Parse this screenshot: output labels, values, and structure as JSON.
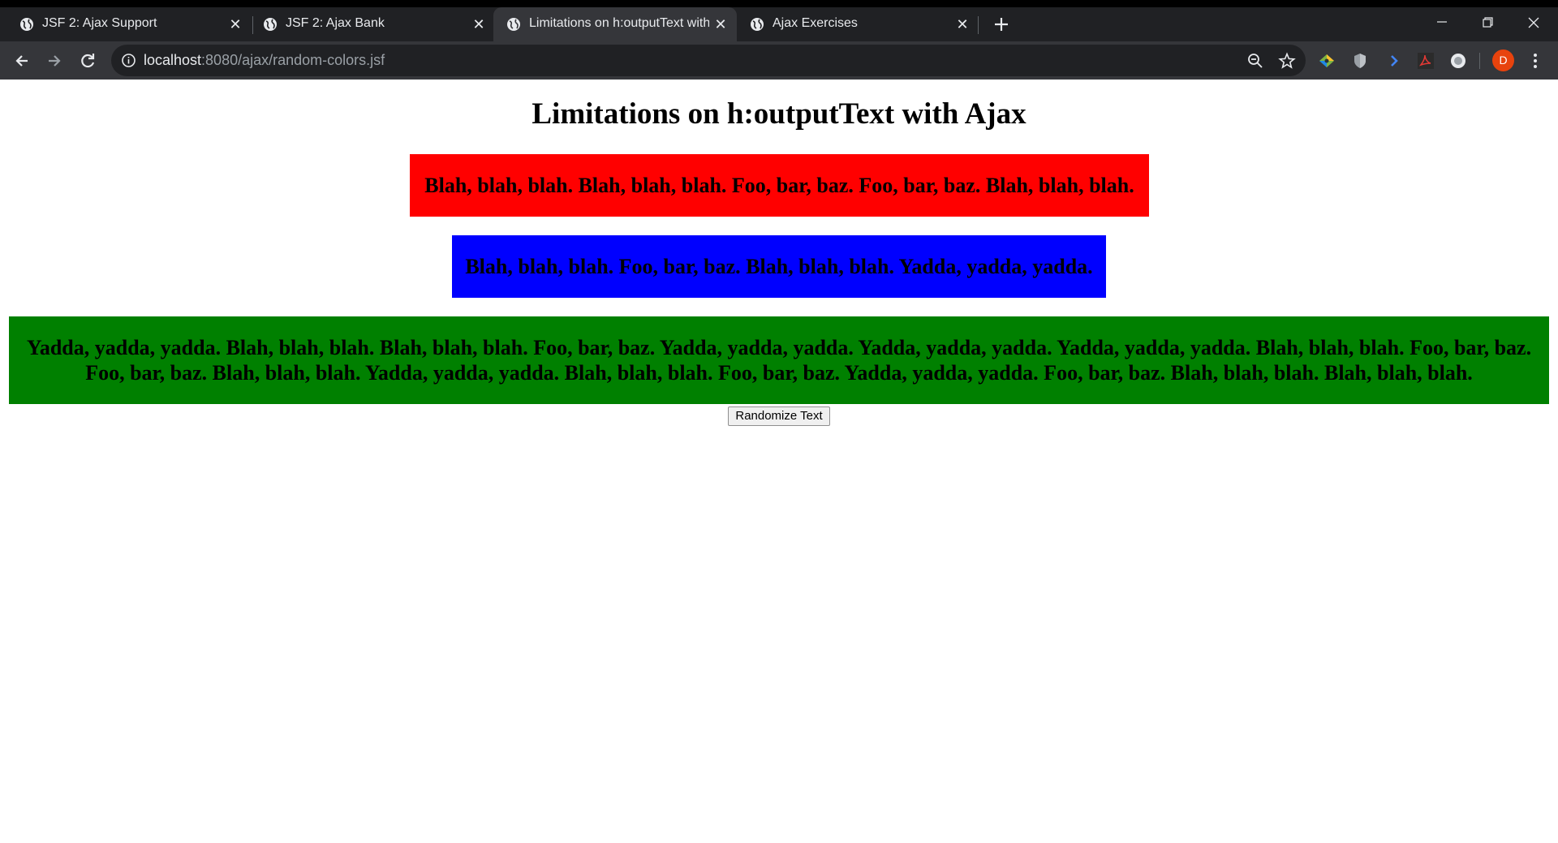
{
  "browser": {
    "tabs": [
      {
        "title": "JSF 2: Ajax Support",
        "active": false
      },
      {
        "title": "JSF 2: Ajax Bank",
        "active": false
      },
      {
        "title": "Limitations on h:outputText with",
        "active": true
      },
      {
        "title": "Ajax Exercises",
        "active": false
      }
    ],
    "url_host": "localhost",
    "url_path": ":8080/ajax/random-colors.jsf",
    "avatar_letter": "D",
    "icons": {
      "favicon": "globe-icon",
      "close": "close-icon",
      "new_tab": "plus-icon",
      "back": "back-arrow-icon",
      "forward": "forward-arrow-icon",
      "reload": "reload-icon",
      "site_info": "info-icon",
      "zoom": "zoom-out-icon",
      "bookmark": "star-icon",
      "menu": "kebab-menu-icon"
    },
    "colors": {
      "tabstrip": "#202124",
      "toolbar": "#35363a",
      "avatar": "#e8430d"
    }
  },
  "page": {
    "title": "Limitations on h:outputText with Ajax",
    "blocks": [
      {
        "text": "Blah, blah, blah. Blah, blah, blah. Foo, bar, baz. Foo, bar, baz. Blah, blah, blah.",
        "color": "#ff0000"
      },
      {
        "text": "Blah, blah, blah. Foo, bar, baz. Blah, blah, blah. Yadda, yadda, yadda.",
        "color": "#0000ff"
      },
      {
        "text": "Yadda, yadda, yadda. Blah, blah, blah. Blah, blah, blah. Foo, bar, baz. Yadda, yadda, yadda. Yadda, yadda, yadda. Yadda, yadda, yadda. Blah, blah, blah. Foo, bar, baz. Foo, bar, baz. Blah, blah, blah. Yadda, yadda, yadda. Blah, blah, blah. Foo, bar, baz. Yadda, yadda, yadda. Foo, bar, baz. Blah, blah, blah. Blah, blah, blah.",
        "color": "#008000"
      }
    ],
    "button_label": "Randomize Text"
  }
}
